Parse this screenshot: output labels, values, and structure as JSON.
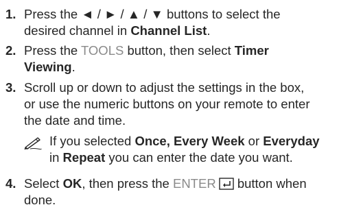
{
  "steps": [
    {
      "number": "1.",
      "l1_pre": "Press the ",
      "l1_arrows": "◄ / ► / ▲ / ▼",
      "l1_post": " buttons to select the",
      "l2_pre": "desired channel in ",
      "l2_bold": "Channel List",
      "l2_post": "."
    },
    {
      "number": "2.",
      "l1_pre": "Press the ",
      "l1_gray": "TOOLS",
      "l1_mid": " button, then select ",
      "l1_bold": "Timer",
      "l2_bold": "Viewing",
      "l2_post": "."
    },
    {
      "number": "3.",
      "l1": "Scroll up or down to adjust the settings in the box,",
      "l2": "or use the numeric buttons on your remote to enter",
      "l3": "the date and time."
    },
    {
      "number": "4.",
      "l1_pre": "Select ",
      "l1_bold": "OK",
      "l1_mid": ", then press the ",
      "l1_gray": "ENTER",
      "l1_post": " button when",
      "l2": "done."
    }
  ],
  "note": {
    "icon": "note-pencil-icon",
    "l1_pre": "If you selected ",
    "l1_bold1": "Once, Every Week",
    "l1_mid": " or ",
    "l1_bold2": "Everyday",
    "l2_pre": "in ",
    "l2_bold": "Repeat",
    "l2_post": " you can enter the date you want."
  },
  "icons": {
    "enter": "enter-key-icon"
  },
  "colors": {
    "text": "#262626",
    "gray_text": "#8a8a8a"
  }
}
